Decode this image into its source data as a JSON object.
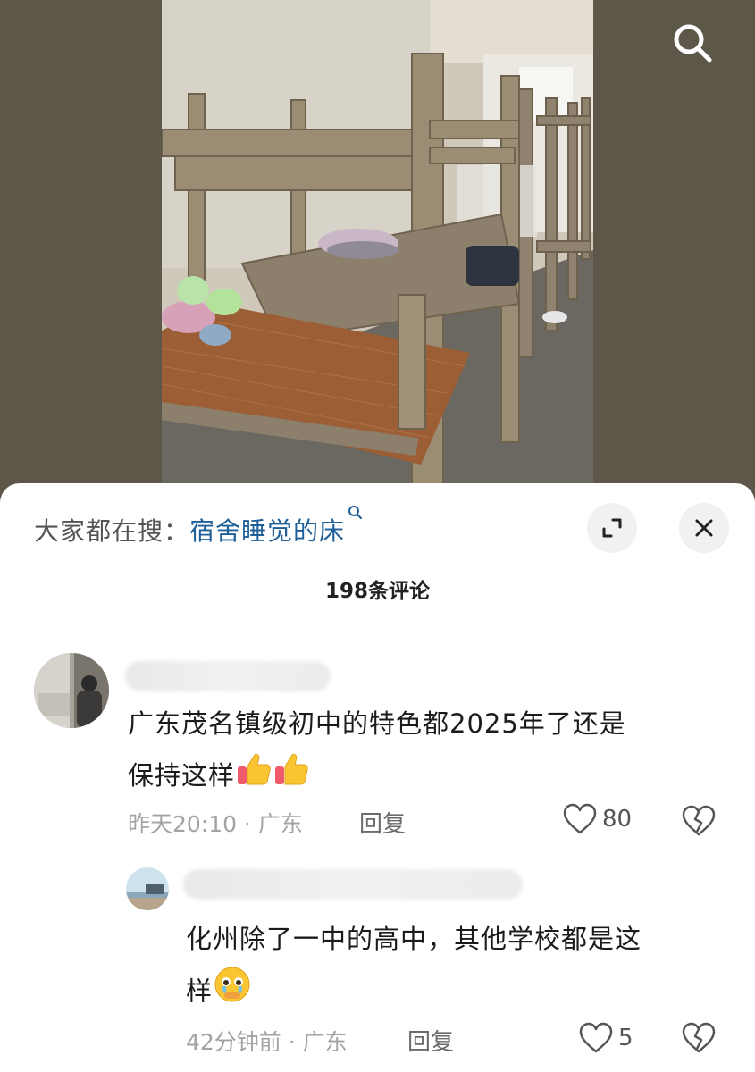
{
  "search_bar": {
    "prefix": "大家都在搜：",
    "term": "宿舍睡觉的床"
  },
  "comment_count": "198条评论",
  "comments": [
    {
      "text_line1": "广东茂名镇级初中的特色都2025年了还是",
      "text_line2": "保持这样",
      "time_location": "昨天20:10 · 广东",
      "reply_label": "回复",
      "likes": "80"
    },
    {
      "text_line1": "化州除了一中的高中，其他学校都是这",
      "text_line2": "样",
      "time_location": "42分钟前 · 广东",
      "reply_label": "回复",
      "likes": "5"
    }
  ],
  "icons": [
    "search-icon",
    "expand-icon",
    "close-icon",
    "heart-icon",
    "broken-heart-icon",
    "thumbs-up-emoji",
    "teary-face-emoji"
  ],
  "colors": {
    "link": "#1f5f99",
    "meta": "#a3a3a3",
    "backdrop": "#5a5448"
  }
}
